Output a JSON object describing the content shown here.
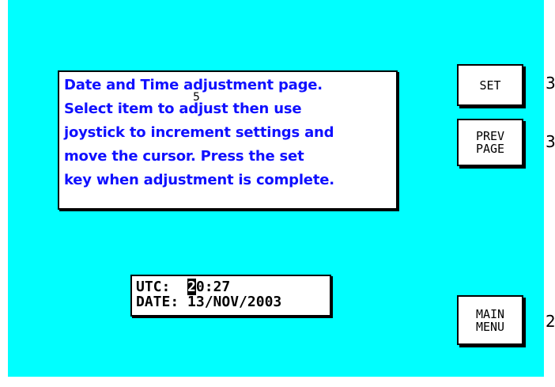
{
  "info": {
    "lines": [
      "Date and Time adjustment page.",
      "Select item to adjust then use",
      "joystick to increment settings and",
      "move the cursor. Press the set",
      "key when adjustment is complete."
    ],
    "cursor_marker": "5"
  },
  "clock": {
    "utc_label": "UTC:",
    "utc_cursor_char": "2",
    "utc_rest": "0:27",
    "date_label": "DATE:",
    "date_value": "13/NOV/2003"
  },
  "softkeys": {
    "set": [
      "SET"
    ],
    "prev": [
      "PREV",
      "PAGE"
    ],
    "main": [
      "MAIN",
      "MENU"
    ],
    "numbers": [
      "3",
      "3",
      "2"
    ]
  },
  "colors": {
    "screen_bg": "#00ffff",
    "info_text": "#1010ff"
  }
}
